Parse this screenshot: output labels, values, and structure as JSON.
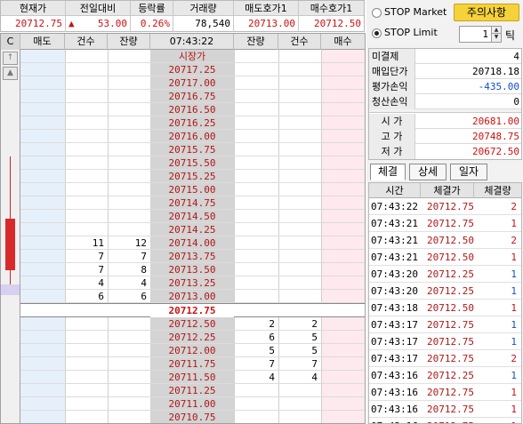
{
  "quote": {
    "headers": [
      "현재가",
      "전일대비",
      "등락률",
      "거래량",
      "매도호가1",
      "매수호가1"
    ],
    "current_price": "20712.75",
    "change_arrow": "▲",
    "change": "53.00",
    "change_rate": "0.26%",
    "volume": "78,540",
    "ask1": "20713.00",
    "bid1": "20712.50"
  },
  "book": {
    "headers": {
      "corner": "C",
      "sell": "매도",
      "sell_count": "건수",
      "sell_remain": "잔량",
      "time": "07:43:22",
      "buy_remain": "잔량",
      "buy_count": "건수",
      "buy": "매수"
    },
    "market_label": "시장가",
    "current_price": "20712.75",
    "ask_rows": [
      {
        "price": "20717.25",
        "cnt": "",
        "qty": ""
      },
      {
        "price": "20717.00",
        "cnt": "",
        "qty": ""
      },
      {
        "price": "20716.75",
        "cnt": "",
        "qty": ""
      },
      {
        "price": "20716.50",
        "cnt": "",
        "qty": ""
      },
      {
        "price": "20716.25",
        "cnt": "",
        "qty": ""
      },
      {
        "price": "20716.00",
        "cnt": "",
        "qty": ""
      },
      {
        "price": "20715.75",
        "cnt": "",
        "qty": ""
      },
      {
        "price": "20715.50",
        "cnt": "",
        "qty": ""
      },
      {
        "price": "20715.25",
        "cnt": "",
        "qty": ""
      },
      {
        "price": "20715.00",
        "cnt": "",
        "qty": ""
      },
      {
        "price": "20714.75",
        "cnt": "",
        "qty": ""
      },
      {
        "price": "20714.50",
        "cnt": "",
        "qty": ""
      },
      {
        "price": "20714.25",
        "cnt": "",
        "qty": ""
      },
      {
        "price": "20714.00",
        "cnt": "11",
        "qty": "12"
      },
      {
        "price": "20713.75",
        "cnt": "7",
        "qty": "7"
      },
      {
        "price": "20713.50",
        "cnt": "7",
        "qty": "8"
      },
      {
        "price": "20713.25",
        "cnt": "4",
        "qty": "4"
      },
      {
        "price": "20713.00",
        "cnt": "6",
        "qty": "6"
      }
    ],
    "bid_rows": [
      {
        "price": "20712.50",
        "qty": "2",
        "cnt": "2"
      },
      {
        "price": "20712.25",
        "qty": "6",
        "cnt": "5"
      },
      {
        "price": "20712.00",
        "qty": "5",
        "cnt": "5"
      },
      {
        "price": "20711.75",
        "qty": "7",
        "cnt": "7"
      },
      {
        "price": "20711.50",
        "qty": "4",
        "cnt": "4"
      },
      {
        "price": "20711.25",
        "qty": "",
        "cnt": ""
      },
      {
        "price": "20711.00",
        "qty": "",
        "cnt": ""
      },
      {
        "price": "20710.75",
        "qty": "",
        "cnt": ""
      }
    ]
  },
  "order": {
    "stop_market": "STOP Market",
    "stop_limit": "STOP Limit",
    "selected": "STOP Limit",
    "warning_button": "주의사항",
    "tick_value": "1",
    "tick_label": "틱"
  },
  "stats": {
    "unfilled_label": "미결제",
    "unfilled": "4",
    "avg_price_label": "매입단가",
    "avg_price": "20718.18",
    "eval_pl_label": "평가손익",
    "eval_pl": "-435.00",
    "settle_pl_label": "청산손익",
    "settle_pl": "0",
    "open_label": "시 가",
    "open": "20681.00",
    "high_label": "고 가",
    "high": "20748.75",
    "low_label": "저 가",
    "low": "20672.50"
  },
  "tabs": [
    "체결",
    "상세",
    "일자"
  ],
  "trades": {
    "headers": [
      "시간",
      "체결가",
      "체결량"
    ],
    "rows": [
      {
        "time": "07:43:22",
        "price": "20712.75",
        "qty": "2",
        "side": "buy"
      },
      {
        "time": "07:43:21",
        "price": "20712.75",
        "qty": "1",
        "side": "buy"
      },
      {
        "time": "07:43:21",
        "price": "20712.50",
        "qty": "2",
        "side": "buy"
      },
      {
        "time": "07:43:21",
        "price": "20712.50",
        "qty": "1",
        "side": "buy"
      },
      {
        "time": "07:43:20",
        "price": "20712.25",
        "qty": "1",
        "side": "sell"
      },
      {
        "time": "07:43:20",
        "price": "20712.25",
        "qty": "1",
        "side": "sell"
      },
      {
        "time": "07:43:18",
        "price": "20712.50",
        "qty": "1",
        "side": "buy"
      },
      {
        "time": "07:43:17",
        "price": "20712.75",
        "qty": "1",
        "side": "sell"
      },
      {
        "time": "07:43:17",
        "price": "20712.75",
        "qty": "1",
        "side": "sell"
      },
      {
        "time": "07:43:17",
        "price": "20712.75",
        "qty": "2",
        "side": "buy"
      },
      {
        "time": "07:43:16",
        "price": "20712.25",
        "qty": "1",
        "side": "sell"
      },
      {
        "time": "07:43:16",
        "price": "20712.75",
        "qty": "1",
        "side": "buy"
      },
      {
        "time": "07:43:16",
        "price": "20712.75",
        "qty": "1",
        "side": "buy"
      },
      {
        "time": "07:43:16",
        "price": "20712.75",
        "qty": "1",
        "side": "buy"
      }
    ]
  },
  "colors": {
    "up": "#cc1010",
    "down": "#1050c8",
    "warning": "#f6d23a"
  }
}
